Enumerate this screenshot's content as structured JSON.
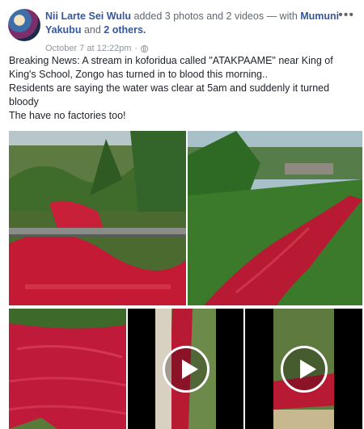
{
  "post": {
    "author": "Nii Larte Sei Wulu",
    "action": "added 3 photos and 2 videos",
    "with_text": "— with",
    "tagged": "Mumuni Yakubu",
    "and_text": "and",
    "others": "2 others.",
    "timestamp": "October 7 at 12:22pm",
    "separator": "·",
    "more_icon": "ellipsis-icon",
    "privacy_icon": "globe-icon",
    "body": [
      "Breaking News: A stream in koforidua called \"ATAKPAAME\" near King of King's School, Zongo has turned in to blood this morning..",
      "Residents are saying the water was clear at 5am and suddenly it turned bloody",
      "The have no factories too!"
    ]
  },
  "media": {
    "photos": [
      {
        "kind": "photo",
        "subject": "red stream under bridge railing"
      },
      {
        "kind": "photo",
        "subject": "red stream through green vegetation"
      },
      {
        "kind": "photo",
        "subject": "close-up red water"
      }
    ],
    "videos": [
      {
        "kind": "video",
        "play_icon": "play-icon"
      },
      {
        "kind": "video",
        "play_icon": "play-icon"
      }
    ]
  },
  "colors": {
    "link": "#365899",
    "meta": "#90949c",
    "text": "#1d2129",
    "red_water": "#c0183a",
    "vegetation": "#3f7a2a"
  }
}
